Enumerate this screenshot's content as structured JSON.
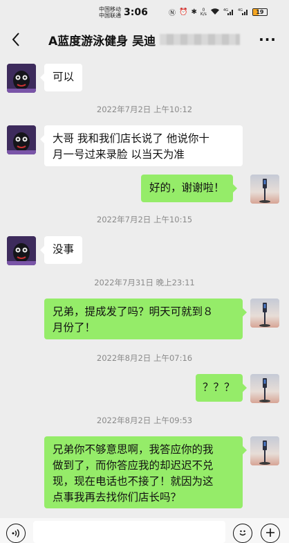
{
  "status_bar": {
    "carrier_1": "中国移动",
    "carrier_2": "中国联通",
    "time": "3:06",
    "speed_value": "0",
    "speed_unit": "K/s",
    "network_1": "4G",
    "network_2": "4G",
    "battery": "19"
  },
  "header": {
    "back_icon": "chevron-left-icon",
    "title": "A蓝度游泳健身 吴迪",
    "more_icon": "more-dots-icon"
  },
  "messages": [
    {
      "side": "left",
      "text": "可以"
    },
    {
      "type": "time",
      "text": "2022年7月2日 上午10:12"
    },
    {
      "side": "left",
      "line1": "大哥 我和我们店长说了  他说你十",
      "line2": "月一号过来录脸 以当天为准"
    },
    {
      "side": "right",
      "text": "好的，谢谢啦！"
    },
    {
      "type": "time",
      "text": "2022年7月2日 上午10:15"
    },
    {
      "side": "left",
      "text": "没事"
    },
    {
      "type": "time",
      "text": "2022年7月31日 晚上23:11"
    },
    {
      "side": "right",
      "line1": "兄弟，提成发了吗？明天可就到８",
      "line2": "月份了！"
    },
    {
      "type": "time",
      "text": "2022年8月2日 上午07:16"
    },
    {
      "side": "right",
      "text": "？？？"
    },
    {
      "type": "time",
      "text": "2022年8月2日 上午09:53"
    },
    {
      "side": "right",
      "line1": "兄弟你不够意思啊，我答应你的我",
      "line2": "做到了，而你答应我的却迟迟不兑",
      "line3": "现，现在电话也不接了！就因为这",
      "line4": "点事我再去找你们店长吗？"
    }
  ],
  "input_bar": {
    "voice_icon": "voice-icon",
    "input_value": "",
    "emoji_icon": "emoji-icon",
    "plus_icon": "plus-icon"
  },
  "colors": {
    "background": "#ededed",
    "sent_bubble": "#95ec69",
    "received_bubble": "#ffffff"
  }
}
